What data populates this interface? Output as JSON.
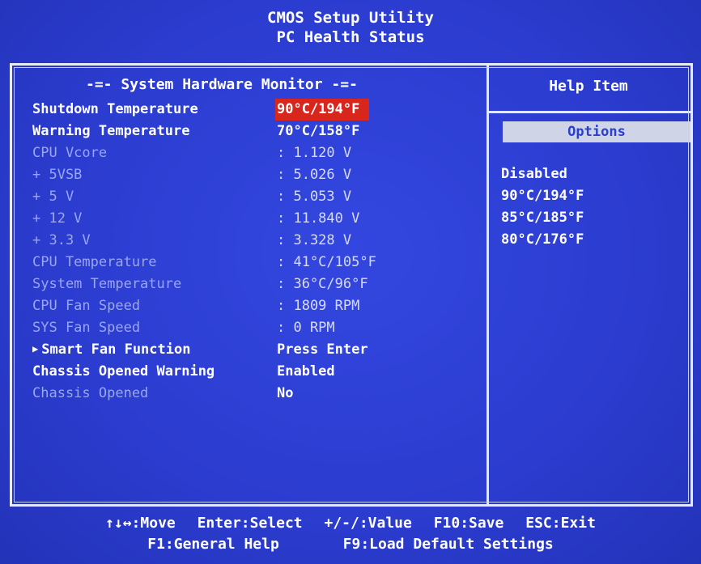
{
  "header": {
    "title": "CMOS Setup Utility",
    "subtitle": "PC Health Status"
  },
  "monitor": {
    "heading": "-=- System Hardware Monitor -=-",
    "rows": [
      {
        "label": "Shutdown Temperature",
        "value": "90°C/194°F"
      },
      {
        "label": "Warning Temperature",
        "value": "70°C/158°F"
      },
      {
        "label": "CPU Vcore",
        "value": ": 1.120 V"
      },
      {
        "label": "+ 5VSB",
        "value": ": 5.026 V"
      },
      {
        "label": "+ 5 V",
        "value": ": 5.053 V"
      },
      {
        "label": "+ 12 V",
        "value": ": 11.840 V"
      },
      {
        "label": "+ 3.3 V",
        "value": ": 3.328 V"
      },
      {
        "label": "CPU Temperature",
        "value": ": 41°C/105°F"
      },
      {
        "label": "System Temperature",
        "value": ": 36°C/96°F"
      },
      {
        "label": "CPU Fan Speed",
        "value": ": 1809 RPM"
      },
      {
        "label": "SYS Fan Speed",
        "value": ": 0 RPM"
      },
      {
        "label": "Smart Fan Function",
        "value": "Press Enter",
        "arrow": "▶"
      },
      {
        "label": "Chassis Opened Warning",
        "value": "Enabled"
      },
      {
        "label": "Chassis Opened",
        "value": "No"
      }
    ]
  },
  "help": {
    "title": "Help Item",
    "options_label": "Options",
    "options": [
      "Disabled",
      "90°C/194°F",
      "85°C/185°F",
      "80°C/176°F"
    ]
  },
  "footer": {
    "move": "↑↓↔:Move",
    "select": "Enter:Select",
    "value": "+/-/:Value",
    "save": "F10:Save",
    "exit": "ESC:Exit",
    "help": "F1:General Help",
    "defaults": "F9:Load Default Settings"
  },
  "colors": {
    "background": "#2a3fd0",
    "selection": "#d8261c",
    "frame": "#e8eaf6",
    "dim_label": "#9aa6ee",
    "options_box": "#cfd4e6"
  }
}
